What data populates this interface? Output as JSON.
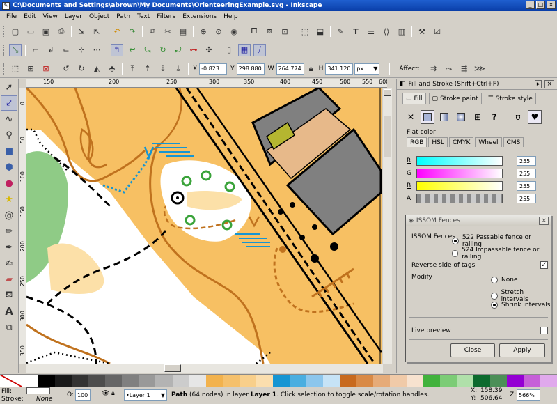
{
  "window": {
    "title": "C:\\Documents and Settings\\abrown\\My Documents\\OrienteeringExample.svg - Inkscape"
  },
  "menu": [
    "File",
    "Edit",
    "View",
    "Layer",
    "Object",
    "Path",
    "Text",
    "Filters",
    "Extensions",
    "Help"
  ],
  "toolbar_main": [
    "new-icon",
    "open-icon",
    "save-icon",
    "print-icon",
    "import-icon",
    "export-icon",
    "undo-icon",
    "redo-icon",
    "copy-icon",
    "cut-icon",
    "paste-icon",
    "zoom-selection-icon",
    "zoom-drawing-icon",
    "zoom-page-icon",
    "duplicate-icon",
    "clone-icon",
    "unlink-clone-icon",
    "group-icon",
    "ungroup-icon",
    "fill-stroke-icon",
    "text-tool-icon",
    "layers-icon",
    "xml-editor-icon",
    "align-icon",
    "preferences-icon",
    "document-properties-icon"
  ],
  "coords": {
    "x_label": "X",
    "x": "-0.823",
    "y_label": "Y",
    "y": "298.880",
    "w_label": "W",
    "w": "264.774",
    "h_label": "H",
    "h": "341.120",
    "unit": "px",
    "affect_label": "Affect:"
  },
  "rulers": {
    "h": [
      "150",
      "200",
      "250",
      "300",
      "350",
      "400",
      "450",
      "500",
      "550",
      "600"
    ],
    "v": [
      "0",
      "50",
      "100",
      "150",
      "200",
      "250",
      "300",
      "350"
    ]
  },
  "fill_stroke": {
    "title": "Fill and Stroke (Shift+Ctrl+F)",
    "tabs": [
      "Fill",
      "Stroke paint",
      "Stroke style"
    ],
    "flat_color": "Flat color",
    "color_tabs": [
      "RGB",
      "HSL",
      "CMYK",
      "Wheel",
      "CMS"
    ],
    "channels": [
      {
        "label": "R",
        "value": "255",
        "gradient": "#00ffff,#ffffff"
      },
      {
        "label": "G",
        "value": "255",
        "gradient": "#ff00ff,#ffffff"
      },
      {
        "label": "B",
        "value": "255",
        "gradient": "#ffff00,#ffffff"
      },
      {
        "label": "A",
        "value": "255",
        "gradient": "checker"
      }
    ]
  },
  "issom": {
    "title": "ISSOM Fences",
    "fences_label": "ISSOM Fences",
    "options": [
      "522 Passable fence or railing",
      "524 Impassable fence or railing"
    ],
    "selected_option": 0,
    "reverse_label": "Reverse side of tags",
    "reverse_checked": true,
    "modify_label": "Modify",
    "modify_options": [
      "None",
      "Stretch intervals",
      "Shrink intervals"
    ],
    "modify_selected": 2,
    "live_preview": "Live preview",
    "close": "Close",
    "apply": "Apply"
  },
  "palette": [
    "#ffffff",
    "#000000",
    "#1a1a1a",
    "#333333",
    "#4d4d4d",
    "#666666",
    "#808080",
    "#999999",
    "#b3b3b3",
    "#cccccc",
    "#e6e6e6",
    "#f2b24d",
    "#f5c06b",
    "#f8cf8b",
    "#fbdeae",
    "#1595d3",
    "#4aaee0",
    "#8cc6ec",
    "#c6e3f6",
    "#c86a1e",
    "#d98a46",
    "#e6ab78",
    "#f0caa8",
    "#f7e2cf",
    "#41b23c",
    "#7ccc76",
    "#b0e0aa",
    "#0c6a2d",
    "#4c8f57",
    "#9400d3",
    "#c65fd8",
    "#e0a9ec"
  ],
  "status": {
    "fill_label": "Fill:",
    "stroke_label": "Stroke:",
    "stroke_value": "None",
    "opacity_label": "O:",
    "opacity": "100",
    "layer": "•Layer 1",
    "message_bold": "Path",
    "message": " (64 nodes) in layer ",
    "message_layer": "Layer 1",
    "message_tail": ". Click selection to toggle scale/rotation handles.",
    "x_label": "X:",
    "x": "158.39",
    "y_label": "Y:",
    "y": "506.64",
    "zoom_label": "Z:",
    "zoom": "566%"
  }
}
